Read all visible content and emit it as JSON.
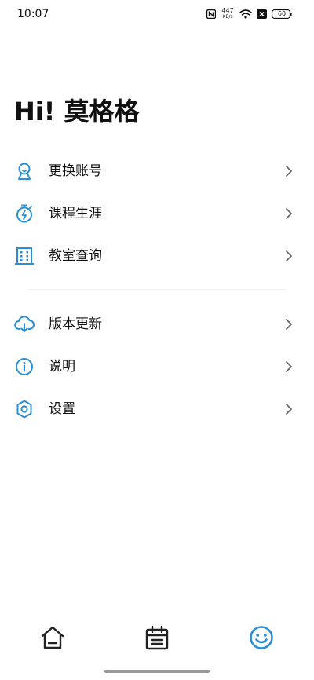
{
  "status_bar": {
    "time": "10:07",
    "net_speed_value": "447",
    "net_speed_unit": "KB/s",
    "battery_level": "60",
    "icons": [
      "nfc-icon",
      "wifi-icon",
      "x-icon",
      "battery-icon"
    ]
  },
  "header": {
    "greeting": "Hi! 莫格格"
  },
  "menu": {
    "group1": [
      {
        "label": "更换账号",
        "icon": "user-switch-icon"
      },
      {
        "label": "课程生涯",
        "icon": "stopwatch-icon"
      },
      {
        "label": "教室查询",
        "icon": "building-icon"
      }
    ],
    "group2": [
      {
        "label": "版本更新",
        "icon": "cloud-download-icon"
      },
      {
        "label": "说明",
        "icon": "info-icon"
      },
      {
        "label": "设置",
        "icon": "gear-icon"
      }
    ]
  },
  "bottom_nav": {
    "items": [
      {
        "icon": "home-icon",
        "active": false
      },
      {
        "icon": "calendar-icon",
        "active": false
      },
      {
        "icon": "smile-icon",
        "active": true
      }
    ]
  },
  "colors": {
    "accent": "#2a8fd4",
    "text": "#111111",
    "chevron": "#666666",
    "nav_inactive": "#222222",
    "divider": "#eeeeee"
  }
}
